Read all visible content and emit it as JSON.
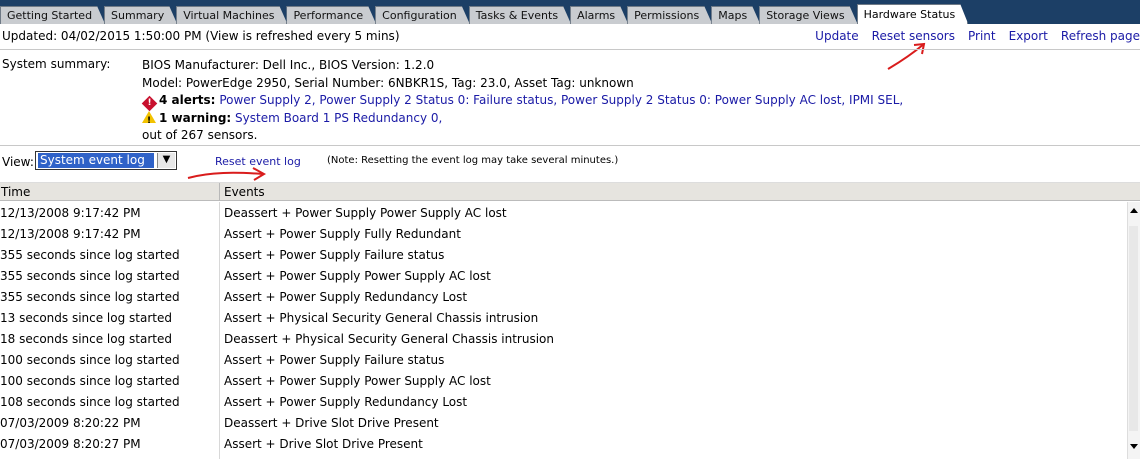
{
  "tabs": [
    {
      "label": "Getting Started"
    },
    {
      "label": "Summary"
    },
    {
      "label": "Virtual Machines"
    },
    {
      "label": "Performance"
    },
    {
      "label": "Configuration"
    },
    {
      "label": "Tasks & Events"
    },
    {
      "label": "Alarms"
    },
    {
      "label": "Permissions"
    },
    {
      "label": "Maps"
    },
    {
      "label": "Storage Views"
    },
    {
      "label": "Hardware Status"
    }
  ],
  "header": {
    "updated_text": "Updated: 04/02/2015  1:50:00 PM (View is refreshed every 5 mins)",
    "actions": {
      "update": "Update",
      "reset_sensors": "Reset sensors",
      "print": "Print",
      "export": "Export",
      "refresh_page": "Refresh page"
    }
  },
  "summary": {
    "label": "System summary:",
    "bios": "BIOS Manufacturer: Dell Inc., BIOS Version: 1.2.0",
    "model": "Model: PowerEdge 2950, Serial Number: 6NBKR1S, Tag: 23.0,  Asset Tag: unknown",
    "alerts_count": "4 alerts:",
    "alerts_list": "Power Supply 2, Power Supply 2 Status 0: Failure status, Power Supply 2 Status 0: Power Supply AC lost, IPMI SEL,",
    "warning_count": "1 warning:",
    "warning_list": "System Board 1 PS Redundancy 0,",
    "sensors_total": "out of 267 sensors."
  },
  "view": {
    "label": "View:",
    "selected": "System event log",
    "reset_link": "Reset event log",
    "note": "(Note: Resetting the event log may take several minutes.)"
  },
  "table": {
    "col_time": "Time",
    "col_events": "Events",
    "rows": [
      {
        "time": "12/13/2008 9:17:42 PM",
        "event": "Deassert + Power Supply Power Supply AC lost"
      },
      {
        "time": "12/13/2008 9:17:42 PM",
        "event": "Assert + Power Supply Fully Redundant"
      },
      {
        "time": "355 seconds since log started",
        "event": "Assert + Power Supply Failure status"
      },
      {
        "time": "355 seconds since log started",
        "event": "Assert + Power Supply Power Supply AC lost"
      },
      {
        "time": "355 seconds since log started",
        "event": "Assert + Power Supply Redundancy Lost"
      },
      {
        "time": "13 seconds since log started",
        "event": "Assert + Physical Security General Chassis intrusion"
      },
      {
        "time": "18 seconds since log started",
        "event": "Deassert + Physical Security General Chassis intrusion"
      },
      {
        "time": "100 seconds since log started",
        "event": "Assert + Power Supply Failure status"
      },
      {
        "time": "100 seconds since log started",
        "event": "Assert + Power Supply Power Supply AC lost"
      },
      {
        "time": "108 seconds since log started",
        "event": "Assert + Power Supply Redundancy Lost"
      },
      {
        "time": "07/03/2009 8:20:22 PM",
        "event": "Deassert + Drive Slot Drive Present"
      },
      {
        "time": "07/03/2009 8:20:27 PM",
        "event": "Assert + Drive Slot Drive Present"
      }
    ]
  },
  "icons": {
    "alert": "alert-diamond-icon",
    "warning": "warning-triangle-icon",
    "dropdown": "chevron-down-icon"
  },
  "colors": {
    "tab_bar": "#1c3f66",
    "link": "#1a1aa6",
    "alert": "#c8102e",
    "warning": "#f2c200",
    "selection": "#2f62c8",
    "annotation_arrow": "#d91c1c"
  }
}
